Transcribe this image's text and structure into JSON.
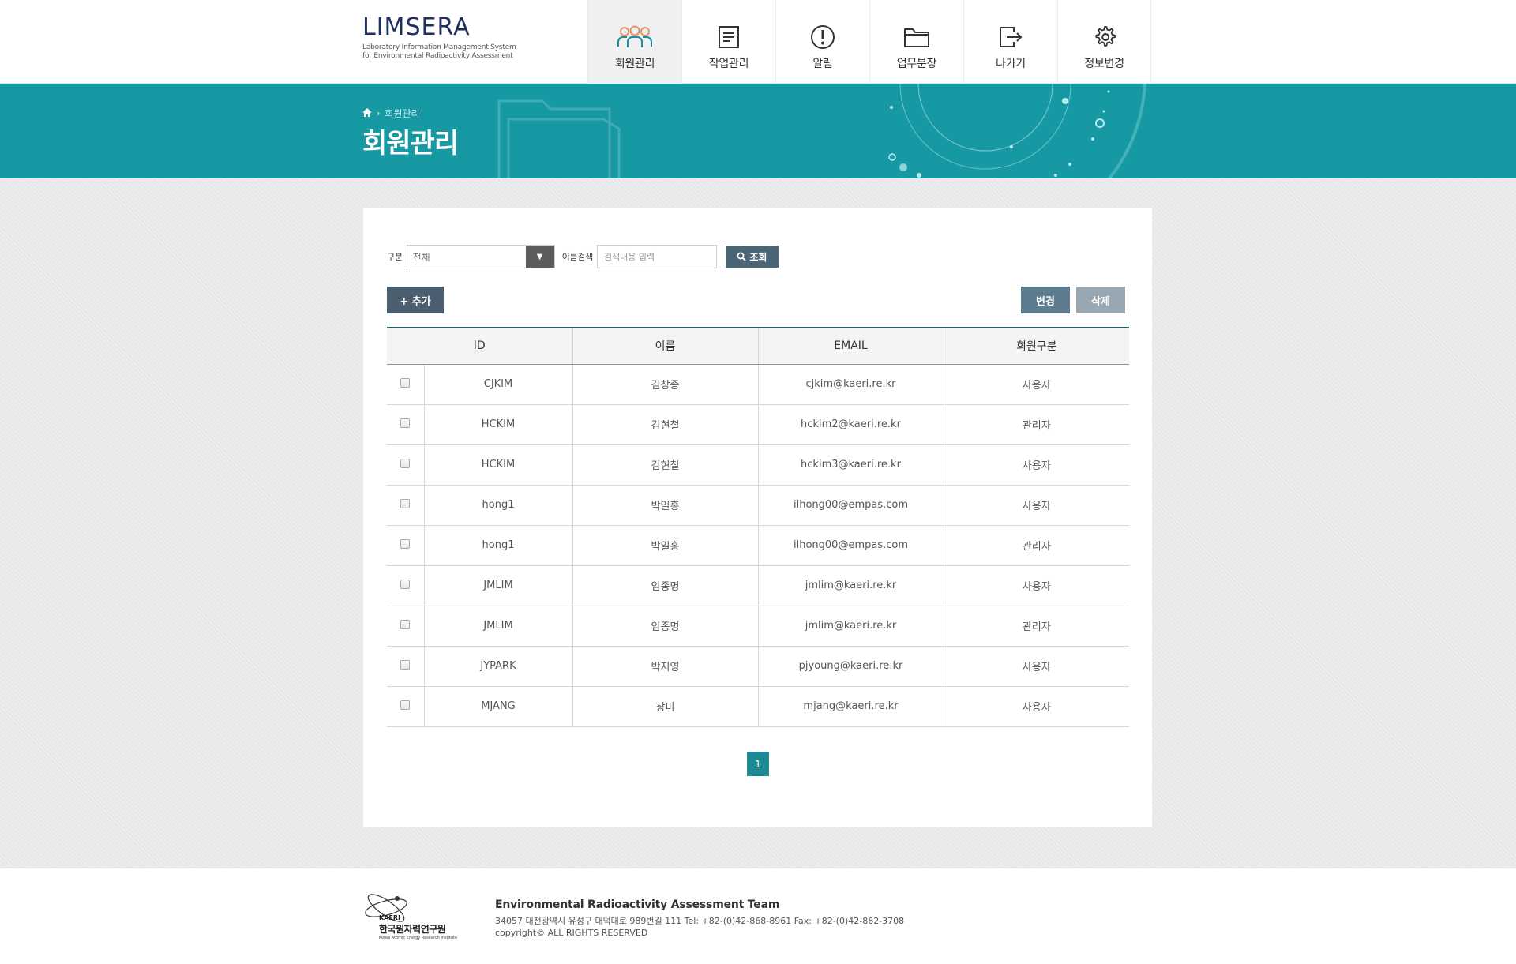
{
  "header": {
    "logo_title": "LIMSERA",
    "logo_sub1": "Laboratory Information Management System",
    "logo_sub2": "for Environmental Radioactivity Assessment",
    "nav": [
      {
        "label": "회원관리",
        "icon": "users-icon",
        "active": true
      },
      {
        "label": "작업관리",
        "icon": "document-icon",
        "active": false
      },
      {
        "label": "알림",
        "icon": "alert-icon",
        "active": false
      },
      {
        "label": "업무분장",
        "icon": "folder-icon",
        "active": false
      },
      {
        "label": "나가기",
        "icon": "logout-icon",
        "active": false
      },
      {
        "label": "정보변경",
        "icon": "gear-icon",
        "active": false
      }
    ]
  },
  "banner": {
    "breadcrumb": "회원관리",
    "title": "회원관리"
  },
  "search": {
    "category_label": "구분",
    "category_value": "전체",
    "name_label": "이름검색",
    "name_placeholder": "검색내용 입력",
    "button_label": "조회"
  },
  "toolbar": {
    "add_label": "+ 추가",
    "edit_label": "변경",
    "delete_label": "삭제"
  },
  "table": {
    "headers": [
      "ID",
      "이름",
      "EMAIL",
      "회원구분"
    ],
    "rows": [
      {
        "id": "CJKIM",
        "name": "김창종",
        "email": "cjkim@kaeri.re.kr",
        "type": "사용자"
      },
      {
        "id": "HCKIM",
        "name": "김현철",
        "email": "hckim2@kaeri.re.kr",
        "type": "관리자"
      },
      {
        "id": "HCKIM",
        "name": "김현철",
        "email": "hckim3@kaeri.re.kr",
        "type": "사용자"
      },
      {
        "id": "hong1",
        "name": "박일홍",
        "email": "ilhong00@empas.com",
        "type": "사용자"
      },
      {
        "id": "hong1",
        "name": "박일홍",
        "email": "ilhong00@empas.com",
        "type": "관리자"
      },
      {
        "id": "JMLIM",
        "name": "임종명",
        "email": "jmlim@kaeri.re.kr",
        "type": "사용자"
      },
      {
        "id": "JMLIM",
        "name": "임종명",
        "email": "jmlim@kaeri.re.kr",
        "type": "관리자"
      },
      {
        "id": "JYPARK",
        "name": "박지영",
        "email": "pjyoung@kaeri.re.kr",
        "type": "사용자"
      },
      {
        "id": "MJANG",
        "name": "장미",
        "email": "mjang@kaeri.re.kr",
        "type": "사용자"
      }
    ]
  },
  "pagination": {
    "current": "1"
  },
  "footer": {
    "org_name": "한국원자력연구원",
    "org_abbr": "KAERI",
    "org_eng": "Korea Atomic Energy Research Institute",
    "team": "Environmental Radioactivity Assessment Team",
    "address": "34057 대전광역시 유성구 대덕대로 989번길 111 Tel: +82-(0)42-868-8961 Fax: +82-(0)42-862-3708",
    "copyright": "copyright© ALL RIGHTS RESERVED"
  },
  "colors": {
    "banner": "#1799a3",
    "accent": "#1d8a93",
    "button_dark": "#4b5f70",
    "button_edit": "#5e7c8f",
    "button_delete": "#98a7b1"
  }
}
